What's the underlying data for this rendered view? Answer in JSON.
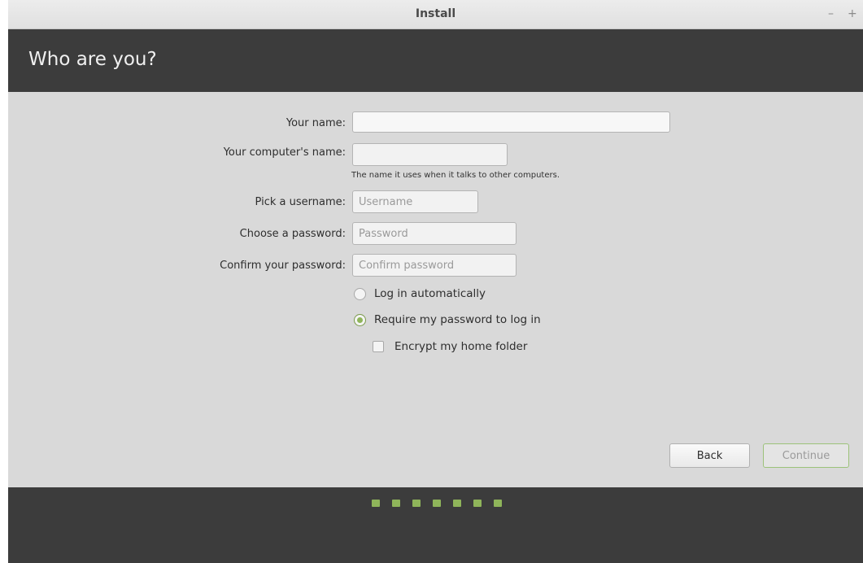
{
  "window": {
    "title": "Install",
    "minimize_glyph": "–",
    "maximize_glyph": "+"
  },
  "header": {
    "heading": "Who are you?"
  },
  "form": {
    "your_name": {
      "label": "Your name:",
      "value": "",
      "placeholder": ""
    },
    "computer_name": {
      "label": "Your computer's name:",
      "value": "",
      "placeholder": "",
      "hint": "The name it uses when it talks to other computers."
    },
    "username": {
      "label": "Pick a username:",
      "value": "",
      "placeholder": "Username"
    },
    "password": {
      "label": "Choose a password:",
      "value": "",
      "placeholder": "Password"
    },
    "confirm_password": {
      "label": "Confirm your password:",
      "value": "",
      "placeholder": "Confirm password"
    },
    "login_options": [
      {
        "label": "Log in automatically",
        "selected": false
      },
      {
        "label": "Require my password to log in",
        "selected": true
      }
    ],
    "encrypt_home": {
      "label": "Encrypt my home folder",
      "checked": false
    }
  },
  "buttons": {
    "back": "Back",
    "continue": "Continue"
  },
  "progress": {
    "total_steps": 7
  },
  "colors": {
    "header_bg": "#3c3c3c",
    "accent_green": "#8fb55a",
    "content_bg": "#d9d9d9"
  }
}
